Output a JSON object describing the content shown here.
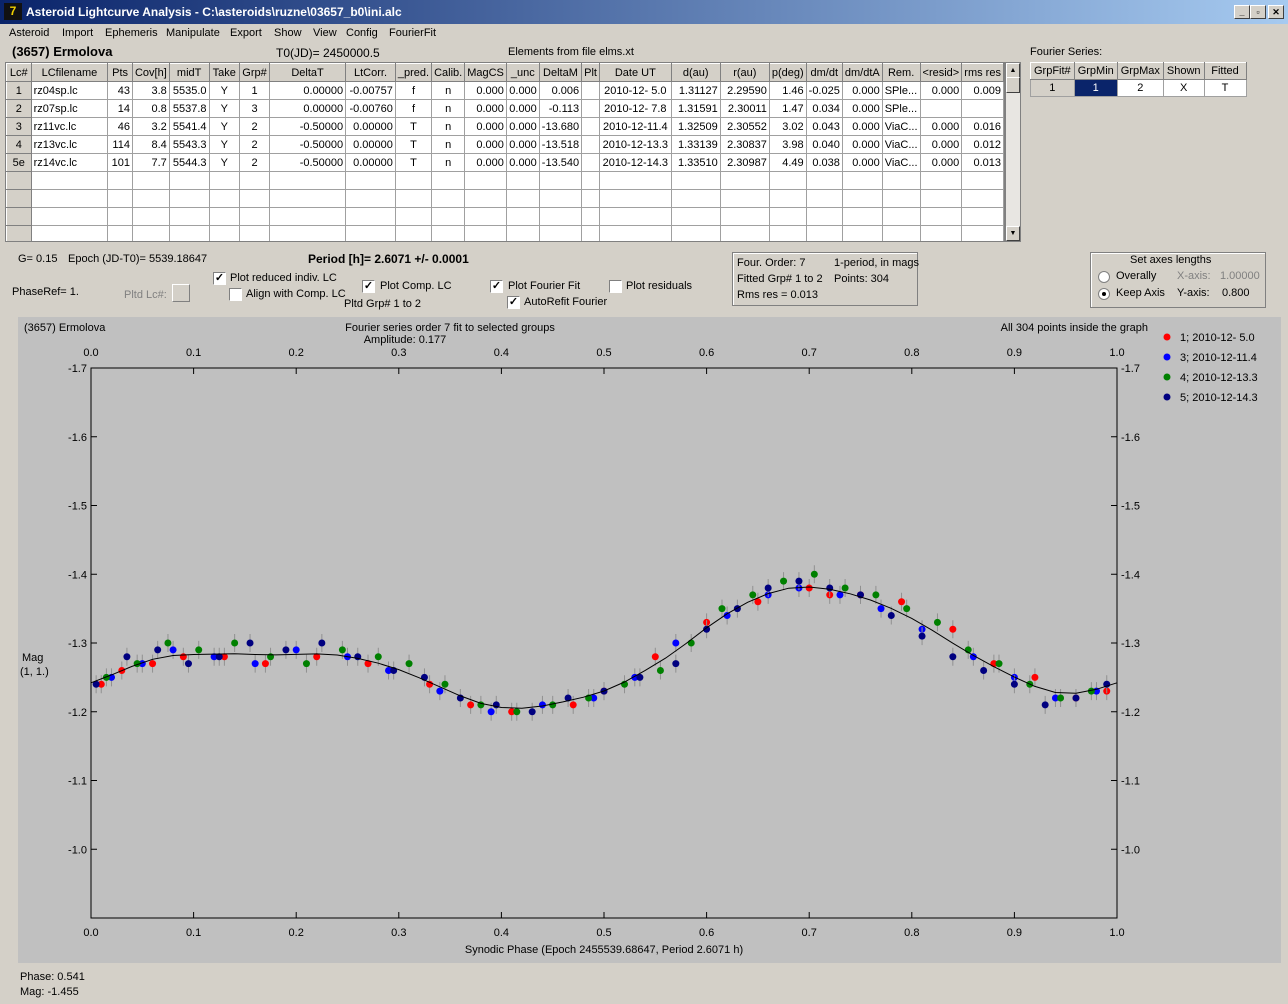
{
  "window": {
    "title": "Asteroid Lightcurve Analysis - C:\\asteroids\\ruzne\\03657_b0\\ini.alc"
  },
  "menu": [
    "Asteroid",
    "Import",
    "Ephemeris",
    "Manipulate",
    "Export",
    "Show",
    "View",
    "Config",
    "FourierFit"
  ],
  "header": {
    "asteroid": "(3657) Ermolova",
    "t0": "T0(JD)= 2450000.5",
    "elements": "Elements from file elms.xt",
    "fourier_label": "Fourier Series:"
  },
  "lc_table": {
    "columns": [
      "Lc#",
      "LCfilename",
      "Pts",
      "Cov[h]",
      "midT",
      "Take",
      "Grp#",
      "DeltaT",
      "LtCorr.",
      "_pred.",
      "Calib.",
      "MagCS",
      "_unc",
      "DeltaM",
      "Plt",
      "Date UT",
      "d(au)",
      "r(au)",
      "p(deg)",
      "dm/dt",
      "dm/dtA",
      "Rem.",
      "<resid>",
      "rms res"
    ],
    "rows": [
      [
        "1",
        "rz04sp.lc",
        "43",
        "3.8",
        "5535.0",
        "Y",
        "1",
        "0.00000",
        "-0.00757",
        "f",
        "n",
        "0.000",
        "0.000",
        "0.006",
        "",
        "2010-12- 5.0",
        "1.31127",
        "2.29590",
        "1.46",
        "-0.025",
        "0.000",
        "SPle...",
        "0.000",
        "0.009"
      ],
      [
        "2",
        "rz07sp.lc",
        "14",
        "0.8",
        "5537.8",
        "Y",
        "3",
        "0.00000",
        "-0.00760",
        "f",
        "n",
        "0.000",
        "0.000",
        "-0.113",
        "",
        "2010-12- 7.8",
        "1.31591",
        "2.30011",
        "1.47",
        "0.034",
        "0.000",
        "SPle...",
        "",
        ""
      ],
      [
        "3",
        "rz11vc.lc",
        "46",
        "3.2",
        "5541.4",
        "Y",
        "2",
        "-0.50000",
        "0.00000",
        "T",
        "n",
        "0.000",
        "0.000",
        "-13.680",
        "",
        "2010-12-11.4",
        "1.32509",
        "2.30552",
        "3.02",
        "0.043",
        "0.000",
        "ViaC...",
        "0.000",
        "0.016"
      ],
      [
        "4",
        "rz13vc.lc",
        "114",
        "8.4",
        "5543.3",
        "Y",
        "2",
        "-0.50000",
        "0.00000",
        "T",
        "n",
        "0.000",
        "0.000",
        "-13.518",
        "",
        "2010-12-13.3",
        "1.33139",
        "2.30837",
        "3.98",
        "0.040",
        "0.000",
        "ViaC...",
        "0.000",
        "0.012"
      ],
      [
        "5e",
        "rz14vc.lc",
        "101",
        "7.7",
        "5544.3",
        "Y",
        "2",
        "-0.50000",
        "0.00000",
        "T",
        "n",
        "0.000",
        "0.000",
        "-13.540",
        "",
        "2010-12-14.3",
        "1.33510",
        "2.30987",
        "4.49",
        "0.038",
        "0.000",
        "ViaC...",
        "0.000",
        "0.013"
      ]
    ]
  },
  "fourier_table": {
    "columns": [
      "GrpFit#",
      "GrpMin",
      "GrpMax",
      "Shown",
      "Fitted"
    ],
    "row": [
      "1",
      "1",
      "2",
      "X",
      "T"
    ]
  },
  "controls": {
    "g_value": "G= 0.15",
    "epoch": "Epoch (JD-T0)= 5539.18647",
    "period": "Period [h]= 2.6071 +/- 0.0001",
    "phaseref": "PhaseRef= 1.",
    "pltd_lc": "Pltd Lc#:",
    "plot_reduced": "Plot reduced indiv. LC",
    "align_comp": "Align with Comp. LC",
    "plot_comp": "Plot Comp. LC",
    "pltd_grp": "Pltd Grp#  1   to   2",
    "plot_fourier": "Plot Fourier Fit",
    "autorefit": "AutoRefit Fourier",
    "plot_residuals": "Plot residuals",
    "checks": {
      "plot_reduced": true,
      "align_comp": false,
      "plot_comp": true,
      "plot_fourier": true,
      "autorefit": true,
      "plot_residuals": false
    },
    "fit_info": {
      "order": "Four. Order:  7",
      "mode": "1-period, in mags",
      "fitted": "Fitted Grp# 1 to 2",
      "points": "Points: 304",
      "rms": "Rms res     = 0.013"
    },
    "axes_box": {
      "title": "Set axes lengths",
      "overally": "Overally",
      "keep_axis": "Keep Axis",
      "xaxis_label": "X-axis:",
      "xaxis_value": "1.00000",
      "yaxis_label": "Y-axis:",
      "yaxis_value": "0.800",
      "selected": "keep_axis"
    }
  },
  "chart_data": {
    "type": "scatter",
    "plot_title": "(3657) Ermolova",
    "subtitle": "Fourier series order 7 fit to selected groups",
    "amplitude": "Amplitude: 0.177",
    "points_note": "All 304 points inside the graph",
    "xlabel": "Synodic Phase (Epoch 2455539.68647, Period 2.6071 h)",
    "ylabel": "Mag",
    "ylabel2": "(1, 1.)",
    "xlim": [
      0.0,
      1.0
    ],
    "ylim": [
      -1.7,
      -0.9
    ],
    "y_inverted": true,
    "x_ticks": [
      "0.0",
      "0.1",
      "0.2",
      "0.3",
      "0.4",
      "0.5",
      "0.6",
      "0.7",
      "0.8",
      "0.9",
      "1.0"
    ],
    "y_ticks": [
      "-1.7",
      "-1.6",
      "-1.5",
      "-1.4",
      "-1.3",
      "-1.2",
      "-1.1",
      "-1.0"
    ],
    "legend_position": "right",
    "series": [
      {
        "name": "1; 2010-12- 5.0",
        "color": "#ff0000",
        "x": [
          0.01,
          0.03,
          0.06,
          0.09,
          0.13,
          0.17,
          0.22,
          0.27,
          0.33,
          0.37,
          0.41,
          0.47,
          0.5,
          0.55,
          0.6,
          0.65,
          0.7,
          0.72,
          0.75,
          0.79,
          0.84,
          0.88,
          0.92,
          0.96,
          0.99
        ],
        "y": [
          -1.24,
          -1.26,
          -1.27,
          -1.28,
          -1.28,
          -1.27,
          -1.28,
          -1.27,
          -1.24,
          -1.21,
          -1.2,
          -1.21,
          -1.23,
          -1.28,
          -1.33,
          -1.36,
          -1.38,
          -1.37,
          -1.37,
          -1.36,
          -1.32,
          -1.27,
          -1.25,
          -1.22,
          -1.23
        ]
      },
      {
        "name": "3; 2010-12-11.4",
        "color": "#0000ff",
        "x": [
          0.02,
          0.05,
          0.08,
          0.12,
          0.16,
          0.2,
          0.25,
          0.29,
          0.34,
          0.39,
          0.44,
          0.49,
          0.53,
          0.57,
          0.62,
          0.66,
          0.69,
          0.73,
          0.77,
          0.81,
          0.86,
          0.9,
          0.94,
          0.98
        ],
        "y": [
          -1.25,
          -1.27,
          -1.29,
          -1.28,
          -1.27,
          -1.29,
          -1.28,
          -1.26,
          -1.23,
          -1.2,
          -1.21,
          -1.22,
          -1.25,
          -1.3,
          -1.34,
          -1.37,
          -1.38,
          -1.37,
          -1.35,
          -1.32,
          -1.28,
          -1.25,
          -1.22,
          -1.23
        ]
      },
      {
        "name": "4; 2010-12-13.3",
        "color": "#008000",
        "x": [
          0.015,
          0.045,
          0.075,
          0.105,
          0.14,
          0.175,
          0.21,
          0.245,
          0.28,
          0.31,
          0.345,
          0.38,
          0.415,
          0.45,
          0.485,
          0.52,
          0.555,
          0.585,
          0.615,
          0.645,
          0.675,
          0.705,
          0.735,
          0.765,
          0.795,
          0.825,
          0.855,
          0.885,
          0.915,
          0.945,
          0.975
        ],
        "y": [
          -1.25,
          -1.27,
          -1.3,
          -1.29,
          -1.3,
          -1.28,
          -1.27,
          -1.29,
          -1.28,
          -1.27,
          -1.24,
          -1.21,
          -1.2,
          -1.21,
          -1.22,
          -1.24,
          -1.26,
          -1.3,
          -1.35,
          -1.37,
          -1.39,
          -1.4,
          -1.38,
          -1.37,
          -1.35,
          -1.33,
          -1.29,
          -1.27,
          -1.24,
          -1.22,
          -1.23
        ]
      },
      {
        "name": "5; 2010-12-14.3",
        "color": "#000080",
        "x": [
          0.005,
          0.035,
          0.065,
          0.095,
          0.125,
          0.155,
          0.19,
          0.225,
          0.26,
          0.295,
          0.325,
          0.36,
          0.395,
          0.43,
          0.465,
          0.5,
          0.535,
          0.57,
          0.6,
          0.63,
          0.66,
          0.69,
          0.72,
          0.75,
          0.78,
          0.81,
          0.84,
          0.87,
          0.9,
          0.93,
          0.96,
          0.99
        ],
        "y": [
          -1.24,
          -1.28,
          -1.29,
          -1.27,
          -1.28,
          -1.3,
          -1.29,
          -1.3,
          -1.28,
          -1.26,
          -1.25,
          -1.22,
          -1.21,
          -1.2,
          -1.22,
          -1.23,
          -1.25,
          -1.27,
          -1.32,
          -1.35,
          -1.38,
          -1.39,
          -1.38,
          -1.37,
          -1.34,
          -1.31,
          -1.28,
          -1.26,
          -1.24,
          -1.21,
          -1.22,
          -1.24
        ]
      }
    ]
  },
  "status": {
    "phase": "Phase:  0.541",
    "mag": "Mag:    -1.455"
  }
}
